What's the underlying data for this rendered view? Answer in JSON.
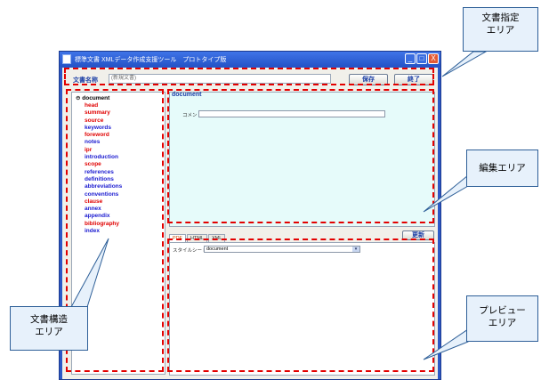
{
  "window": {
    "title": "標準文書 XMLデータ作成支援ツール　プロトタイプ版",
    "controls": [
      "_",
      "□",
      "X"
    ]
  },
  "header": {
    "doc_name_label": "文書名称",
    "doc_name_value": "(新規文書)",
    "save_label": "保存",
    "exit_label": "終了"
  },
  "tree": {
    "root": "⊖ document",
    "items": [
      {
        "label": "head",
        "color": "#e00000"
      },
      {
        "label": "summary",
        "color": "#e00000"
      },
      {
        "label": "source",
        "color": "#e00000"
      },
      {
        "label": "keywords",
        "color": "#1a1ad0"
      },
      {
        "label": "foreword",
        "color": "#e00000"
      },
      {
        "label": "notes",
        "color": "#1a1ad0"
      },
      {
        "label": "ipr",
        "color": "#e00000"
      },
      {
        "label": "introduction",
        "color": "#1a1ad0"
      },
      {
        "label": "scope",
        "color": "#e00000"
      },
      {
        "label": "references",
        "color": "#1a1ad0"
      },
      {
        "label": "definitions",
        "color": "#1a1ad0"
      },
      {
        "label": "abbreviations",
        "color": "#1a1ad0"
      },
      {
        "label": "conventions",
        "color": "#1a1ad0"
      },
      {
        "label": "clause",
        "color": "#e00000"
      },
      {
        "label": "annex",
        "color": "#1a1ad0"
      },
      {
        "label": "appendix",
        "color": "#1a1ad0"
      },
      {
        "label": "bibliography",
        "color": "#e00000"
      },
      {
        "label": "index",
        "color": "#1a1ad0"
      }
    ]
  },
  "editor": {
    "heading": "document",
    "comment_label": "コメント",
    "comment_value": ""
  },
  "preview": {
    "tabs": [
      "PDF",
      "HTML",
      "XML"
    ],
    "active_tab": "PDF",
    "update_label": "更新",
    "stylesheet_label": "スタイルシート",
    "stylesheet_value": "document"
  },
  "callouts": {
    "doc_spec": "文書指定\nエリア",
    "edit": "編集エリア",
    "preview": "プレビュー\nエリア",
    "structure": "文書構造\nエリア"
  },
  "colors": {
    "annotation_red": "#e30000",
    "window_blue": "#2c58c8",
    "editor_bg": "#e6fbfa",
    "callout_bg": "#e7f1fb"
  }
}
